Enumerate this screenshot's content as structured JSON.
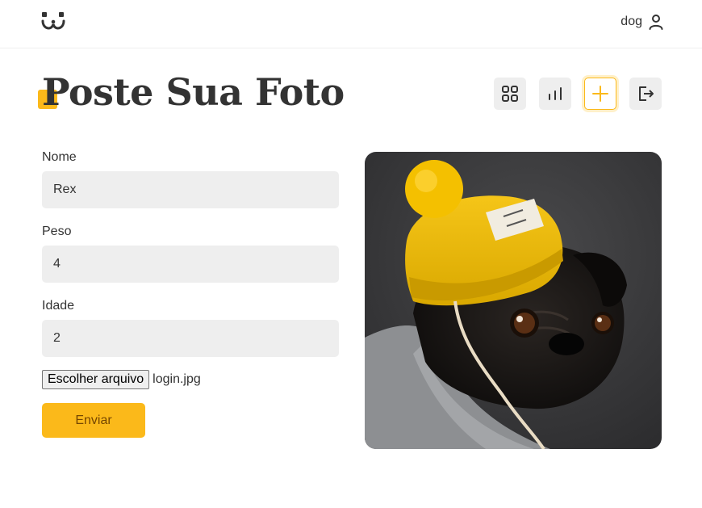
{
  "header": {
    "logo": "dogs-logo-icon",
    "user_label": "dog",
    "user_icon": "user-icon"
  },
  "page": {
    "title": "Poste Sua Foto"
  },
  "nav": [
    {
      "icon": "grid-icon",
      "active": false
    },
    {
      "icon": "stats-icon",
      "active": false
    },
    {
      "icon": "plus-icon",
      "active": true
    },
    {
      "icon": "logout-icon",
      "active": false
    }
  ],
  "form": {
    "nome": {
      "label": "Nome",
      "value": "Rex"
    },
    "peso": {
      "label": "Peso",
      "value": "4"
    },
    "idade": {
      "label": "Idade",
      "value": "2"
    },
    "file_button": "Escolher arquivo",
    "file_name": "login.jpg",
    "submit_label": "Enviar"
  },
  "preview": {
    "image": "pug-in-yellow-beanie-photo"
  },
  "colors": {
    "accent": "#fbb91a",
    "accent_text": "#764701",
    "field_bg": "#eeeeee",
    "text": "#333333"
  }
}
